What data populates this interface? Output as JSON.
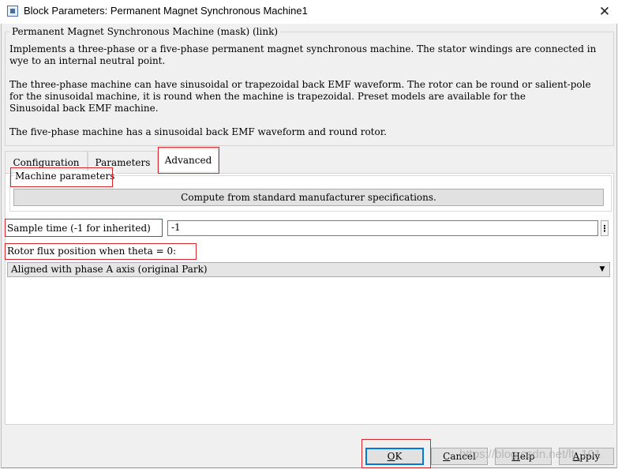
{
  "window": {
    "title": "Block Parameters: Permanent Magnet Synchronous Machine1",
    "close_glyph": "✕",
    "icon": "simulink-block-icon"
  },
  "mask": {
    "legend": "Permanent Magnet Synchronous Machine (mask) (link)",
    "description": [
      "Implements a three-phase or a five-phase permanent magnet synchronous machine. The stator windings are connected in",
      "wye to an internal neutral point.",
      "The three-phase machine can have sinusoidal or trapezoidal back EMF waveform. The rotor can be round or salient-pole",
      "for the sinusoidal machine, it is round when the machine is trapezoidal. Preset models are available for the",
      "Sinusoidal back EMF machine.",
      "The five-phase machine has a sinusoidal back EMF waveform and round rotor."
    ]
  },
  "tabs": [
    {
      "label": "Configuration",
      "active": false
    },
    {
      "label": "Parameters",
      "active": false
    },
    {
      "label": "Advanced",
      "active": true
    }
  ],
  "advanced": {
    "machine_parameters_label": "Machine parameters",
    "compute_button": "Compute from standard manufacturer specifications.",
    "sample_time_label": "Sample time (-1 for inherited)",
    "sample_time_value": "-1",
    "more_options_glyph": "⋮",
    "rotor_flux_label": "Rotor flux position when theta = 0:",
    "rotor_flux_selected": "Aligned with phase A axis (original Park)",
    "dropdown_arrow": "▼"
  },
  "buttons": {
    "ok": {
      "mnemonic": "O",
      "rest": "K"
    },
    "cancel": {
      "mnemonic": "C",
      "rest": "ancel"
    },
    "help": {
      "mnemonic": "H",
      "rest": "elp"
    },
    "apply": {
      "mnemonic": "A",
      "rest": "pply"
    }
  },
  "watermark": "https://blog.csdn.net/lt_101",
  "colors": {
    "highlight_box": "#d9262c",
    "focus_border": "#0078d7",
    "dialog_bg": "#f0f0f0",
    "panel_bg": "#ffffff"
  }
}
